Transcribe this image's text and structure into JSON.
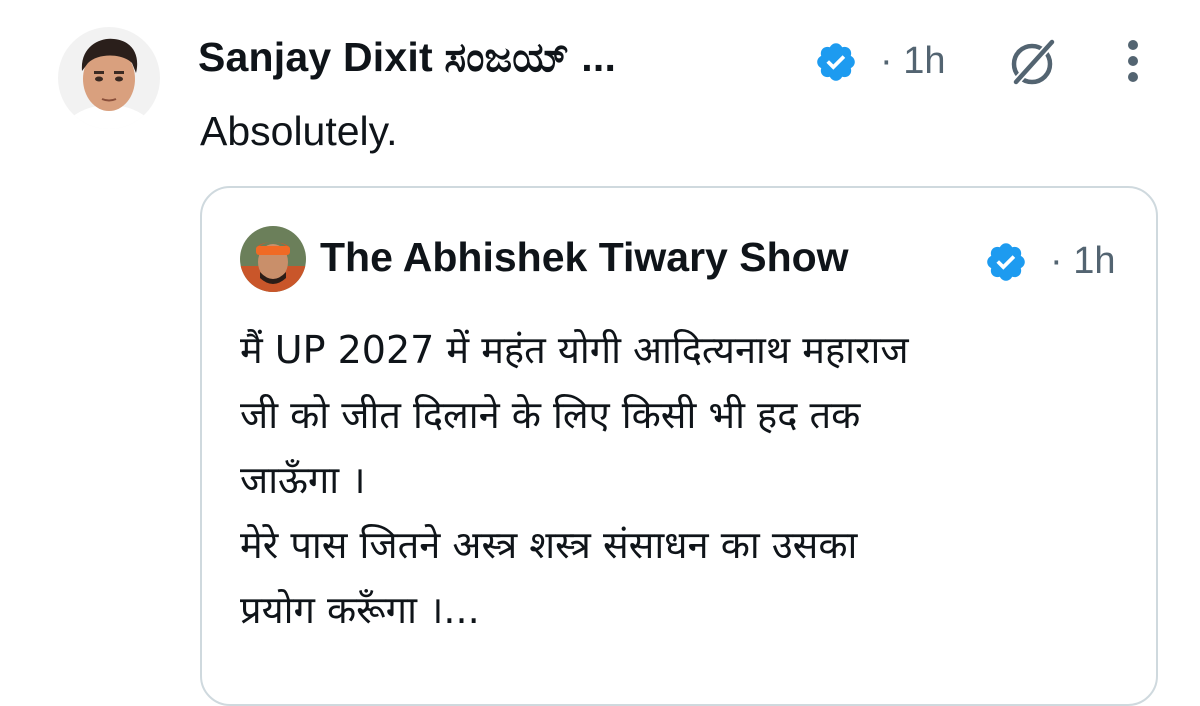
{
  "post": {
    "author_name": "Sanjay Dixit ಸಂಜಯ್ ...",
    "time": "· 1h",
    "text": "Absolutely.",
    "icons": [
      "verified-badge-icon",
      "grok-icon",
      "more-vertical-icon"
    ],
    "colors": {
      "verified_blue": "#1d9bf0",
      "secondary_text": "#536471",
      "card_border": "#cfd9de"
    }
  },
  "quote": {
    "author_name": "The Abhishek Tiwary Show",
    "time": "· 1h",
    "lines": [
      "मैं UP 2027 में महंत योगी आदित्यनाथ महाराज",
      "जी को जीत दिलाने के लिए किसी भी हद तक",
      "जाऊँगा ।",
      "मेरे पास जितने अस्त्र शस्त्र संसाधन का उसका",
      "प्रयोग करूँगा ।..."
    ]
  }
}
